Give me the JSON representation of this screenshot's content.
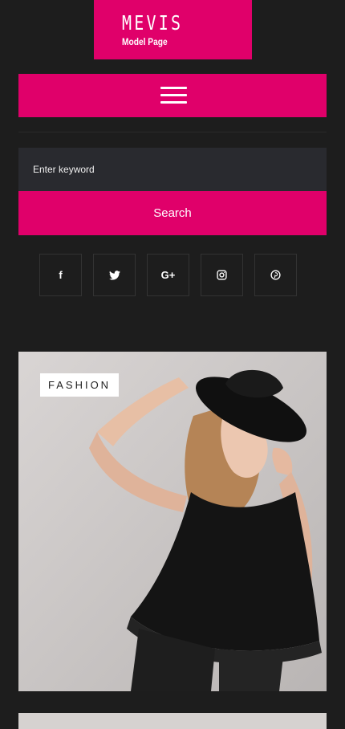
{
  "brand": {
    "title": "MEVIS",
    "subtitle": "Model Page"
  },
  "menu": {
    "icon": "hamburger-menu-icon"
  },
  "search": {
    "placeholder": "Enter keyword",
    "button_label": "Search"
  },
  "social": [
    {
      "name": "facebook",
      "glyph": "f"
    },
    {
      "name": "twitter",
      "glyph": ""
    },
    {
      "name": "google-plus",
      "glyph": "G+"
    },
    {
      "name": "instagram",
      "glyph": ""
    },
    {
      "name": "pinterest",
      "glyph": ""
    }
  ],
  "post": {
    "category": "FASHION"
  },
  "colors": {
    "accent": "#e0006a",
    "background": "#1d1d1d",
    "input_bg": "#292a2f"
  }
}
